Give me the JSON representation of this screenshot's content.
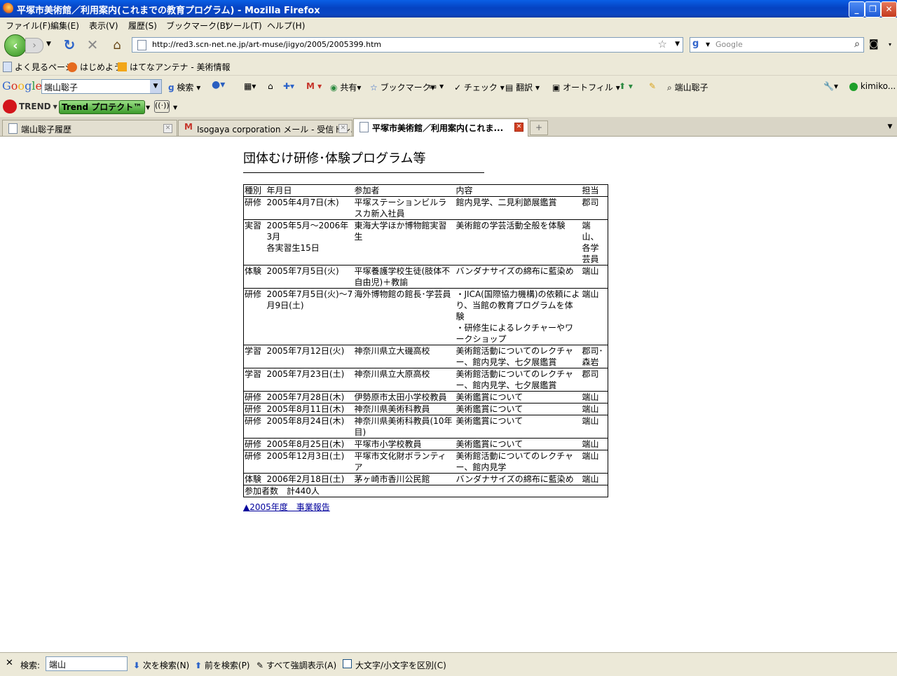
{
  "window": {
    "title": "平塚市美術館／利用案内(これまでの教育プログラム) - Mozilla Firefox"
  },
  "menu": [
    "ファイル(F)",
    "編集(E)",
    "表示(V)",
    "履歴(S)",
    "ブックマーク(B)",
    "ツール(T)",
    "ヘルプ(H)"
  ],
  "nav": {
    "url": "http://red3.scn-net.ne.jp/art-muse/jigyo/2005/2005399.htm",
    "search_placeholder": "Google"
  },
  "bookmarks": [
    "よく見るページ",
    "はじめよう",
    "はてなアンテナ - 美術情報"
  ],
  "google_toolbar": {
    "logo": "Google",
    "query": "端山聡子",
    "search": "検索",
    "share": "共有",
    "bookmarks": "ブックマーク",
    "check": "チェック",
    "translate": "翻訳",
    "autofill": "オートフィル",
    "highlight_term": "端山聡子",
    "account": "kimiko..."
  },
  "trend_toolbar": {
    "logo": "TREND",
    "protect": "Trend プロテクト™"
  },
  "tabs": [
    {
      "label": "端山聡子履歴"
    },
    {
      "label": "Isogaya corporation メール - 受信トレ..."
    },
    {
      "label": "平塚市美術館／利用案内(これま..."
    }
  ],
  "page": {
    "heading": "団体むけ研修･体験プログラム等",
    "table": {
      "headers": [
        "種別",
        "年月日",
        "参加者",
        "内容",
        "担当"
      ],
      "rows": [
        [
          "研修",
          "2005年4月7日(木)",
          "平塚ステーションビルラスカ新入社員",
          "館内見学、二見利節展鑑賞",
          "郡司"
        ],
        [
          "実習",
          "2005年5月～2006年3月\n各実習生15日",
          "東海大学ほか博物館実習生",
          "美術館の学芸活動全般を体験",
          "端山、各学芸員"
        ],
        [
          "体験",
          "2005年7月5日(火)",
          "平塚養護学校生徒(肢体不自由児)＋教諭",
          "バンダナサイズの綿布に藍染め",
          "端山"
        ],
        [
          "研修",
          "2005年7月5日(火)～7月9日(土)",
          "海外博物館の館長･学芸員",
          "・JICA(国際協力機構)の依頼により、当館の教育プログラムを体験\n・研修生によるレクチャーやワークショップ",
          "端山"
        ],
        [
          "学習",
          "2005年7月12日(火)",
          "神奈川県立大磯高校",
          "美術館活動についてのレクチャー、館内見学、七夕展鑑賞",
          "郡司･森岩"
        ],
        [
          "学習",
          "2005年7月23日(土)",
          "神奈川県立大原高校",
          "美術館活動についてのレクチャー、館内見学、七夕展鑑賞",
          "郡司"
        ],
        [
          "研修",
          "2005年7月28日(木)",
          "伊勢原市太田小学校教員",
          "美術鑑賞について",
          "端山"
        ],
        [
          "研修",
          "2005年8月11日(木)",
          "神奈川県美術科教員",
          "美術鑑賞について",
          "端山"
        ],
        [
          "研修",
          "2005年8月24日(木)",
          "神奈川県美術科教員(10年目)",
          "美術鑑賞について",
          "端山"
        ],
        [
          "研修",
          "2005年8月25日(木)",
          "平塚市小学校教員",
          "美術鑑賞について",
          "端山"
        ],
        [
          "研修",
          "2005年12月3日(土)",
          "平塚市文化財ボランティア",
          "美術館活動についてのレクチャー、館内見学",
          "端山"
        ],
        [
          "体験",
          "2006年2月18日(土)",
          "茅ヶ崎市香川公民館",
          "バンダナサイズの綿布に藍染め",
          "端山"
        ]
      ],
      "total": "参加者数　計440人"
    },
    "report_link": "▲2005年度　事業報告"
  },
  "findbar": {
    "label": "検索:",
    "query": "端山",
    "next": "次を検索(N)",
    "prev": "前を検索(P)",
    "highlight": "すべて強調表示(A)",
    "match_case": "大文字/小文字を区別(C)"
  }
}
